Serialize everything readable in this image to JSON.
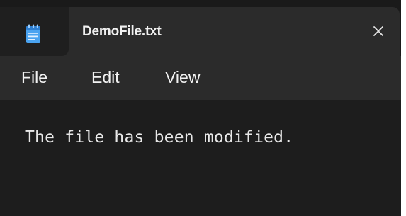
{
  "window": {
    "tab_title": "DemoFile.txt",
    "app_icon": "notepad-icon",
    "close_icon": "close-icon",
    "close_glyph": "✕"
  },
  "menu": {
    "items": [
      {
        "label": "File"
      },
      {
        "label": "Edit"
      },
      {
        "label": "View"
      }
    ]
  },
  "editor": {
    "content": "The file has been modified."
  },
  "colors": {
    "background": "#202020",
    "tab_background": "#2b2b2b",
    "text": "#f0f0f0",
    "icon_accent": "#4aa3f0"
  }
}
